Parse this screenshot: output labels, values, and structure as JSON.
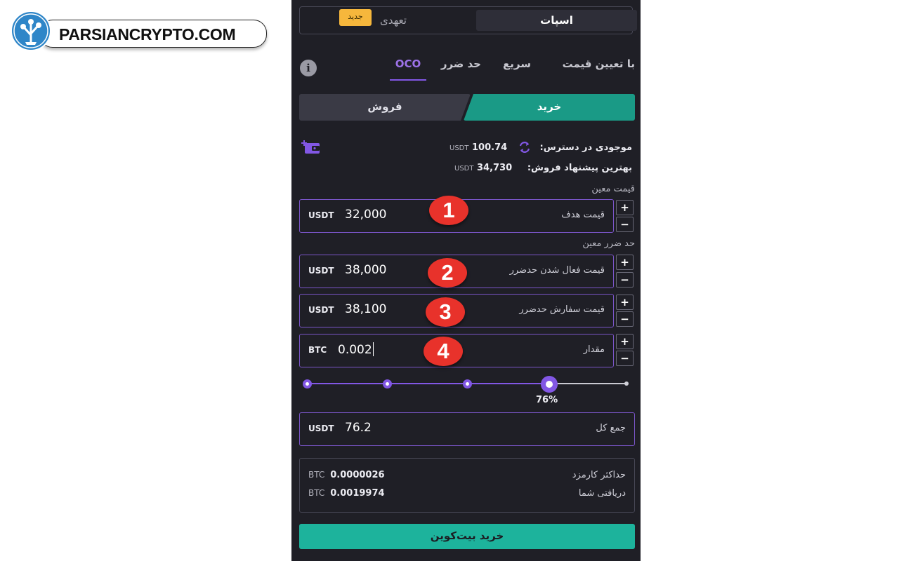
{
  "watermark": {
    "text": "PARSIANCRYPTO.COM"
  },
  "tabs": {
    "spot": "اسپات",
    "margin": "تعهدی",
    "new_badge": "جدید"
  },
  "order_types": [
    {
      "label": "با تعیین قیمت",
      "active": false
    },
    {
      "label": "سریع",
      "active": false
    },
    {
      "label": "حد ضرر",
      "active": false
    },
    {
      "label": "OCO",
      "active": true
    }
  ],
  "side": {
    "buy": "خرید",
    "sell": "فروش"
  },
  "balance": {
    "label": "موجودی در دسترس:",
    "value": "100.74",
    "unit": "USDT"
  },
  "best_offer": {
    "label": "بهترین پیشنهاد فروش:",
    "value": "34,730",
    "unit": "USDT"
  },
  "sections": {
    "limit": "قیمت معین",
    "stop": "حد ضرر معین"
  },
  "fields": {
    "target": {
      "label": "قیمت هدف",
      "value": "32,000",
      "unit": "USDT",
      "marker": "1"
    },
    "trigger": {
      "label": "قیمت فعال شدن حدضرر",
      "value": "38,000",
      "unit": "USDT",
      "marker": "2"
    },
    "stop_order": {
      "label": "قیمت سفارش حدضرر",
      "value": "38,100",
      "unit": "USDT",
      "marker": "3"
    },
    "amount": {
      "label": "مقدار",
      "value": "0.002",
      "unit": "BTC",
      "marker": "4"
    }
  },
  "stepper": {
    "plus": "+",
    "minus": "−"
  },
  "slider": {
    "percent": 76,
    "percent_label": "76%"
  },
  "total": {
    "label": "جمع کل",
    "value": "76.2",
    "unit": "USDT"
  },
  "fees": {
    "max_fee": {
      "label": "حداکثر کارمزد",
      "value": "0.0000026",
      "unit": "BTC"
    },
    "receive": {
      "label": "دریافتی شما",
      "value": "0.0019974",
      "unit": "BTC"
    }
  },
  "submit": {
    "label": "خرید بیت‌کوین"
  },
  "colors": {
    "accent": "#8257e5",
    "buy": "#1a9a86",
    "submit": "#1db39c",
    "badge": "#f6b73c",
    "marker": "#e8322b"
  }
}
